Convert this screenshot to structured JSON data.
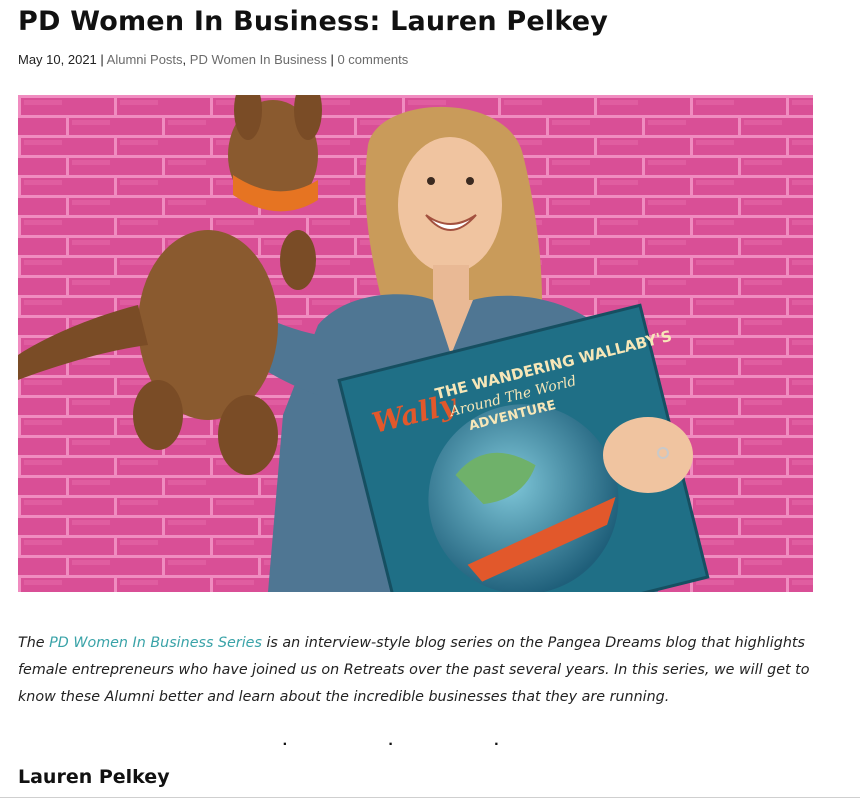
{
  "post": {
    "title": "PD Women In Business: Lauren Pelkey",
    "date": "May 10, 2021",
    "separator": " | ",
    "categories": [
      "Alumni Posts",
      "PD Women In Business"
    ],
    "category_join": ", ",
    "comments": "0 comments"
  },
  "hero_image": {
    "book_title_line1": "Wally",
    "book_title_line2": "THE WANDERING WALLABY'S",
    "book_title_line3": "Around The World",
    "book_title_line4": "ADVENTURE",
    "colors": {
      "brick_wall": "#d94f96",
      "mortar": "#f08cc0",
      "denim": "#4f7693",
      "book_cover": "#1f6f86"
    }
  },
  "intro": {
    "prefix": "The ",
    "link_text": "PD Women In Business Series",
    "rest": " is an interview-style blog series on the Pangea Dreams blog that highlights female entrepreneurs who have joined us on Retreats over the past several years. In this series, we will get to know these Alumni better and learn about the incredible businesses that they are running."
  },
  "divider": "· · ·",
  "section_heading": "Lauren Pelkey",
  "theme": {
    "link_color": "#3aa3a8",
    "meta_link_color": "#6b6b6b"
  }
}
